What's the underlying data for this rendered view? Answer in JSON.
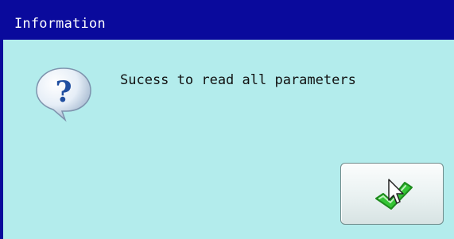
{
  "window": {
    "title": "Information"
  },
  "dialog": {
    "message": "Sucess to read all parameters",
    "icon": "question-bubble-icon",
    "ok_button": {
      "icon": "checkmark-icon"
    }
  },
  "colors": {
    "titlebar": "#0a0a9c",
    "title_text": "#ffffff",
    "body_background": "#b3ecec",
    "checkmark": "#2fbf2f"
  }
}
